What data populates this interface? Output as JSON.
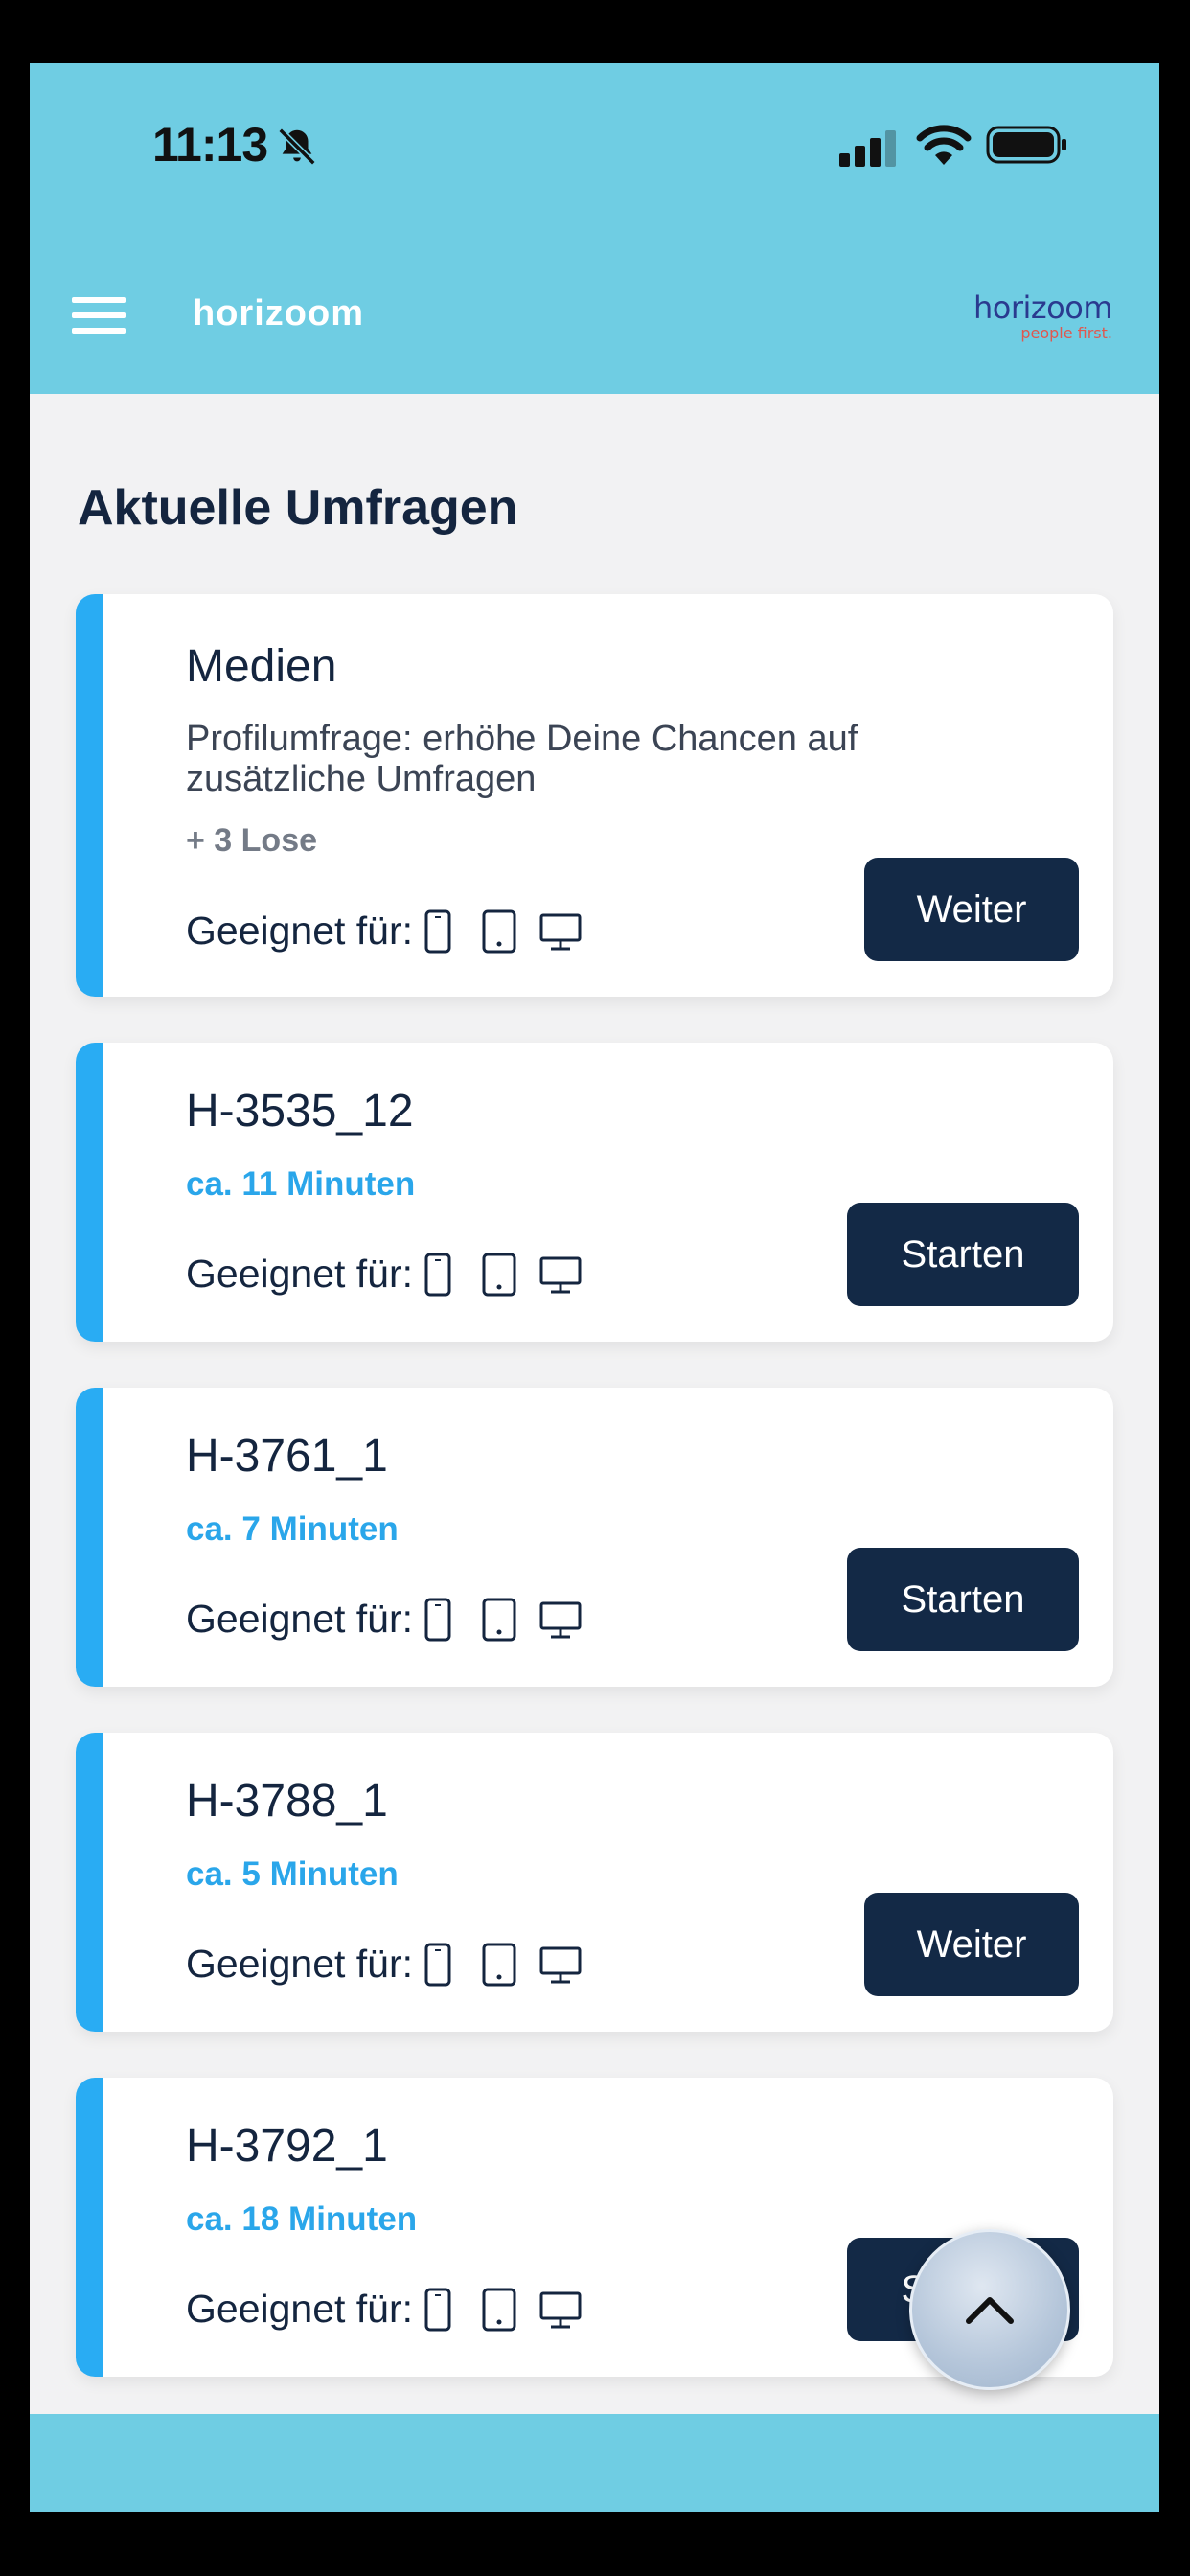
{
  "status_bar": {
    "time": "11:13"
  },
  "header": {
    "title": "horizoom",
    "brand_main": "horizoom",
    "brand_sub": "people first."
  },
  "section": {
    "title": "Aktuelle Umfragen"
  },
  "devices_label": "Geeignet für:",
  "cards": [
    {
      "title": "Medien",
      "description": "Profilumfrage: erhöhe Deine Chancen auf zusätzliche Umfragen",
      "bonus": "+ 3 Lose",
      "button": "Weiter"
    },
    {
      "title": "H-3535_12",
      "duration": "ca. 11 Minuten",
      "button": "Starten"
    },
    {
      "title": "H-3761_1",
      "duration": "ca. 7 Minuten",
      "button": "Starten"
    },
    {
      "title": "H-3788_1",
      "duration": "ca. 5 Minuten",
      "button": "Weiter"
    },
    {
      "title": "H-3792_1",
      "duration": "ca. 18 Minuten",
      "button": "Starten"
    }
  ],
  "colors": {
    "header": "#6fcde3",
    "accent": "#29acf3",
    "button": "#132946",
    "title": "#14253f"
  },
  "icons": [
    "bell-slash-icon",
    "signal-icon",
    "wifi-icon",
    "battery-icon",
    "menu-icon",
    "smartphone-icon",
    "tablet-icon",
    "desktop-icon",
    "chevron-up-icon"
  ]
}
